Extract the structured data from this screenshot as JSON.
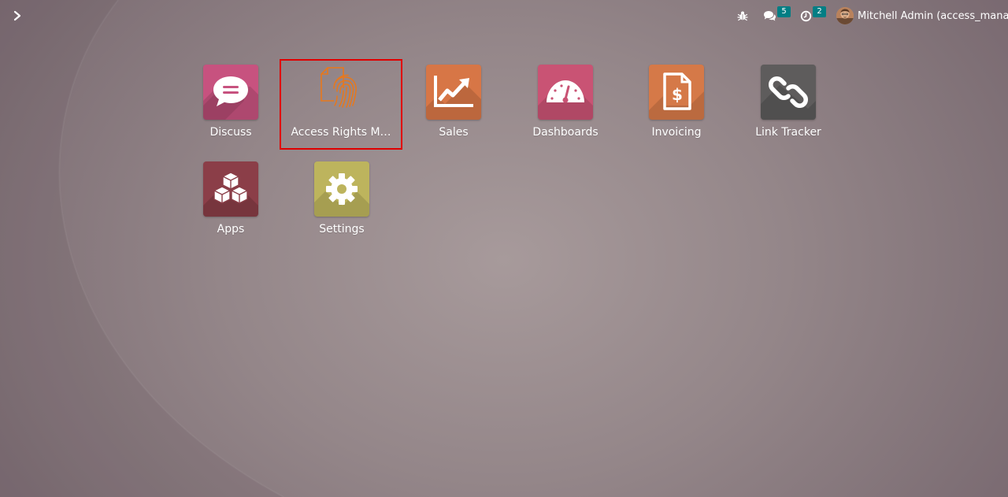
{
  "navbar": {
    "menu_toggle_icon": "chevron-right-icon",
    "debug_icon": "bug-icon",
    "messages_icon": "chat-bubbles-icon",
    "messages_count": "5",
    "activities_icon": "clock-icon",
    "activities_count": "2",
    "user_name": "Mitchell Admin (access_manager"
  },
  "apps": [
    {
      "label": "Discuss",
      "icon": "speech-bubble-icon",
      "color": "#c7527f"
    },
    {
      "label": "Access Rights M…",
      "icon": "fingerprint-document-icon",
      "color": "#e8781c"
    },
    {
      "label": "Sales",
      "icon": "trend-chart-icon",
      "color": "#d77646"
    },
    {
      "label": "Dashboards",
      "icon": "gauge-icon",
      "color": "#c95374"
    },
    {
      "label": "Invoicing",
      "icon": "invoice-dollar-icon",
      "color": "#d57948"
    },
    {
      "label": "Link Tracker",
      "icon": "chain-link-icon",
      "color": "#5e5c5c"
    },
    {
      "label": "Apps",
      "icon": "cubes-icon",
      "color": "#8b3e48"
    },
    {
      "label": "Settings",
      "icon": "gear-icon",
      "color": "#bdb45d"
    }
  ],
  "highlight_color": "#e00000",
  "badge_color": "#017e84"
}
